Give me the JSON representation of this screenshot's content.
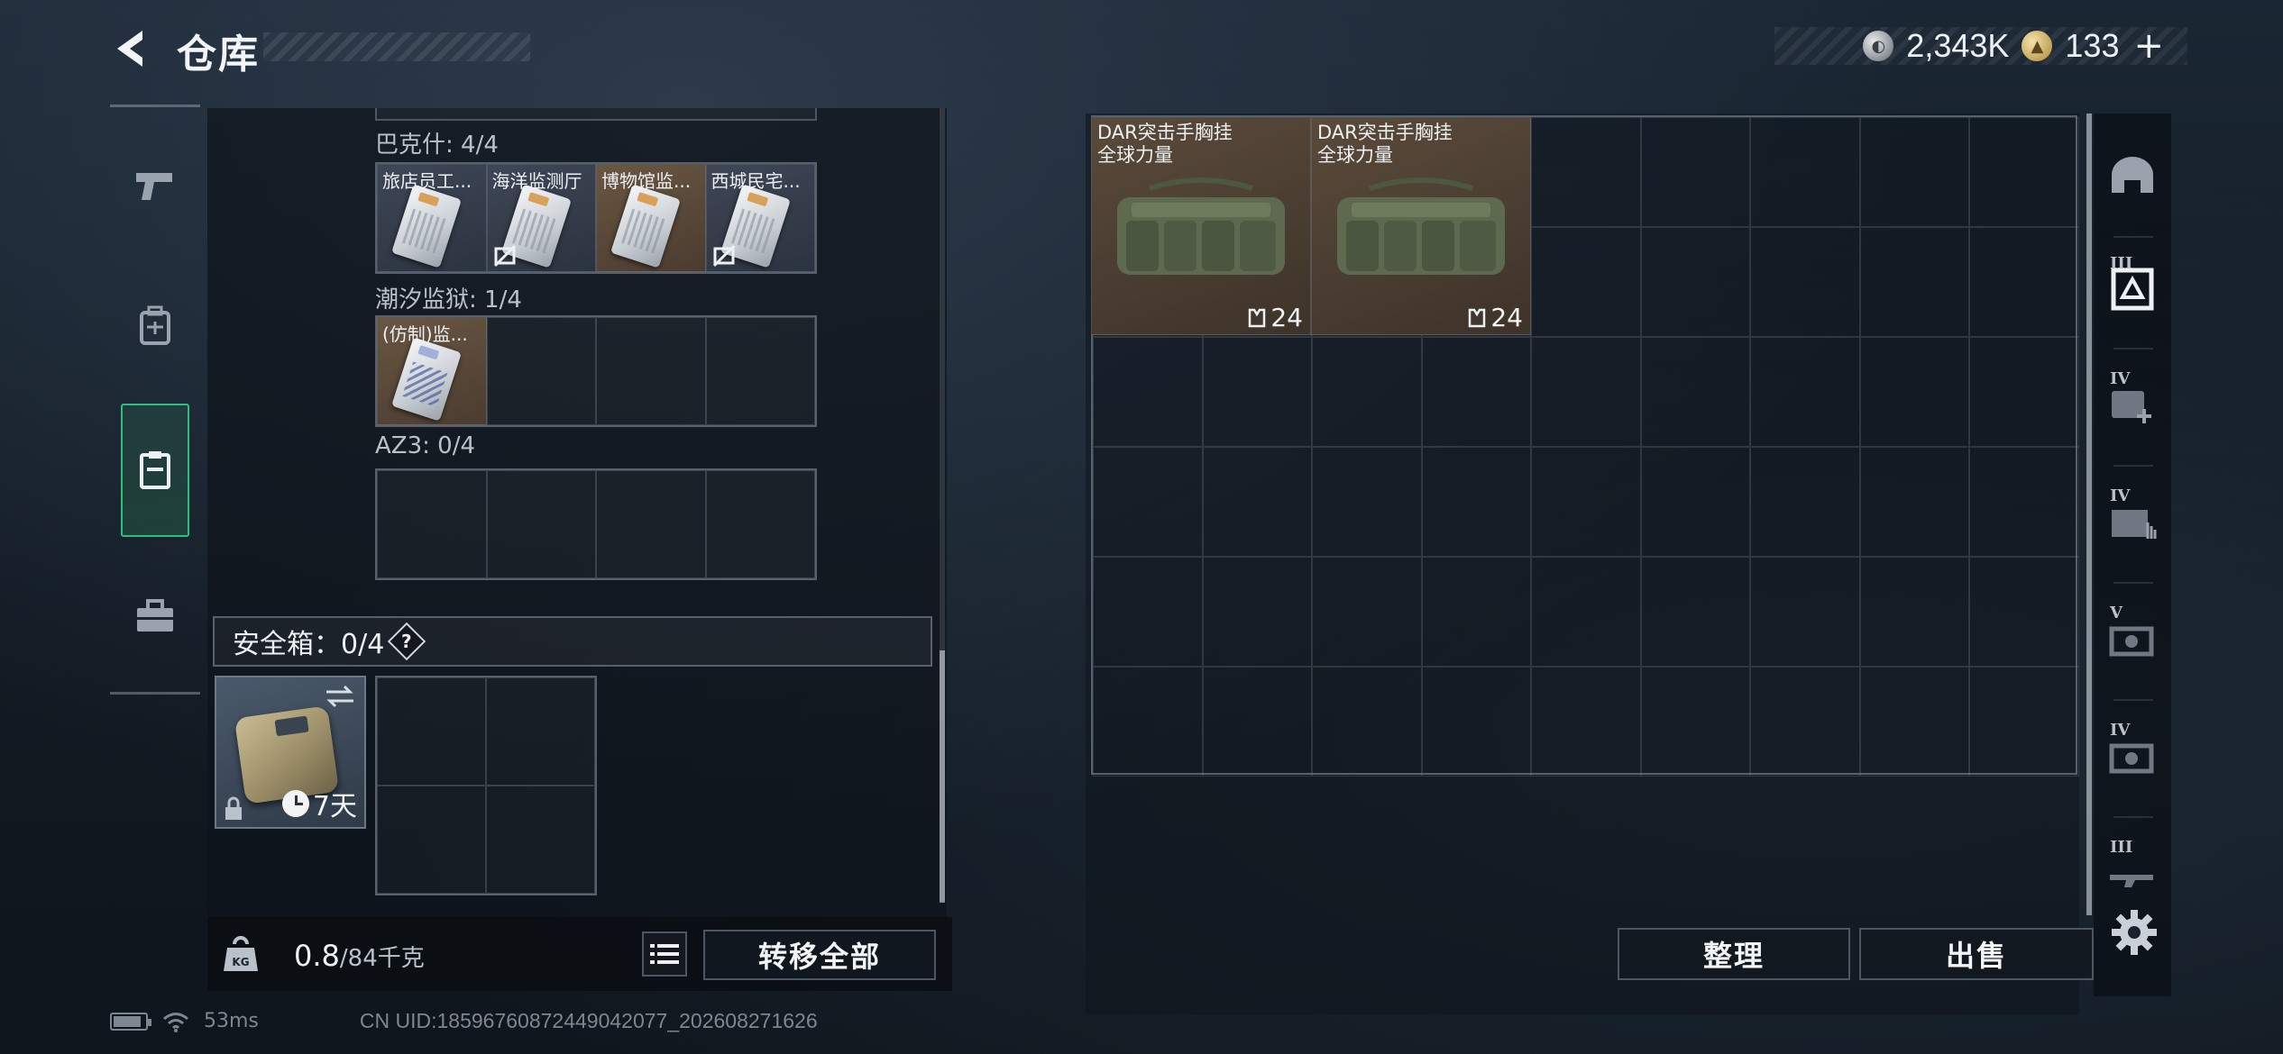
{
  "header": {
    "title": "仓库",
    "currency_silver": "2,343K",
    "currency_gold": "133",
    "plus_label": "+"
  },
  "nav": {
    "items": [
      {
        "name": "weapons",
        "icon": "pistol-icon"
      },
      {
        "name": "gear",
        "icon": "backpack-icon"
      },
      {
        "name": "keycards",
        "icon": "keycard-holder-icon",
        "active": true
      },
      {
        "name": "toolbox",
        "icon": "briefcase-icon"
      }
    ]
  },
  "keycard_groups": [
    {
      "label": "巴克什: 4/4",
      "cards": [
        {
          "label": "旅店员工...",
          "bg": "blue",
          "disabled": false
        },
        {
          "label": "海洋监测厅",
          "bg": "blue",
          "disabled": true
        },
        {
          "label": "博物馆监...",
          "bg": "tan",
          "disabled": false
        },
        {
          "label": "西城民宅...",
          "bg": "blue",
          "disabled": true
        }
      ]
    },
    {
      "label": "潮汐监狱: 1/4",
      "cards": [
        {
          "label": "(仿制)监...",
          "bg": "tan",
          "disabled": false
        }
      ]
    },
    {
      "label": "AZ3: 0/4",
      "cards": []
    }
  ],
  "safe_box": {
    "title": "安全箱：0/4",
    "help": "?",
    "days": "7天"
  },
  "weight": {
    "current": "0.8",
    "max": "/84千克",
    "kg_label": "KG"
  },
  "buttons": {
    "transfer_all": "转移全部",
    "arrange": "整理",
    "sell": "出售"
  },
  "stash_items": [
    {
      "name_line1": "DAR突击手胸挂",
      "name_line2": "全球力量",
      "count": "24"
    },
    {
      "name_line1": "DAR突击手胸挂",
      "name_line2": "全球力量",
      "count": "24"
    }
  ],
  "side_tabs": [
    {
      "icon": "helmet-icon",
      "tier": ""
    },
    {
      "icon": "armor-vest-icon",
      "tier": "III"
    },
    {
      "icon": "medkit-icon",
      "tier": "IV"
    },
    {
      "icon": "container-icon",
      "tier": "IV"
    },
    {
      "icon": "safe-icon",
      "tier": "V"
    },
    {
      "icon": "safe-icon",
      "tier": "IV"
    },
    {
      "icon": "rifle-icon",
      "tier": "III"
    }
  ],
  "footer": {
    "ping": "53ms",
    "uid": "CN UID:18596760872449042077_202608271626"
  },
  "colors": {
    "accent_green": "#2fbf7a",
    "item_tan": "#5a4a3a",
    "item_blue": "#3e4756"
  }
}
